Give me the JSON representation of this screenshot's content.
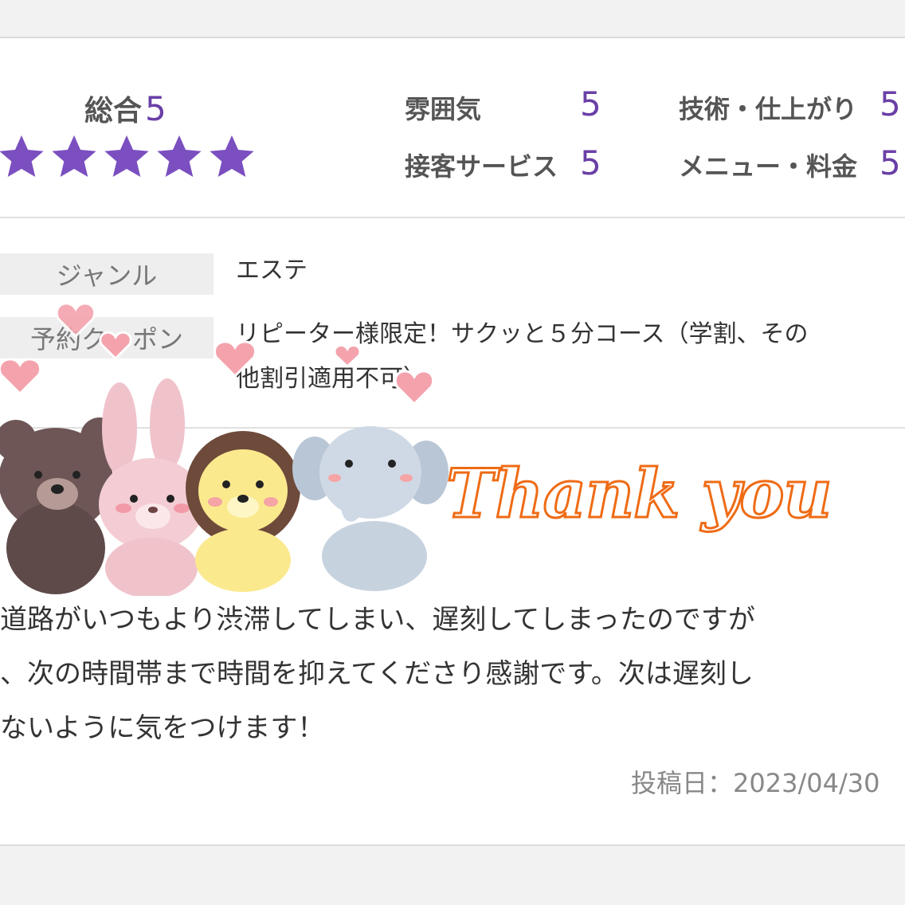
{
  "ratings": {
    "overall_label": "総合",
    "overall_value": "5",
    "star_count": 5,
    "star_color": "#7b4fc0",
    "items": [
      {
        "label": "雰囲気",
        "value": "5"
      },
      {
        "label": "技術・仕上がり",
        "value": "5"
      },
      {
        "label": "接客サービス",
        "value": "5"
      },
      {
        "label": "メニュー・料金",
        "value": "5"
      }
    ]
  },
  "info": {
    "genre_label": "ジャンル",
    "genre_value": "エステ",
    "coupon_label": "予約クーポン",
    "coupon_line1": "リピーター様限定！サクッと５分コース（学割、その",
    "coupon_line2": "他割引適用不可）"
  },
  "sticker": {
    "text": "Thank you",
    "text_color": "#ef6b14"
  },
  "comment": {
    "line1": "道路がいつもより渋滞してしまい、遅刻してしまったのですが",
    "line2": "、次の時間帯まで時間を抑えてくださり感謝です。次は遅刻し",
    "line3": "ないように気をつけます！"
  },
  "posted": "投稿日：2023/04/30",
  "colors": {
    "accent": "#6a3fa6",
    "label_bg": "#eeeeee"
  }
}
